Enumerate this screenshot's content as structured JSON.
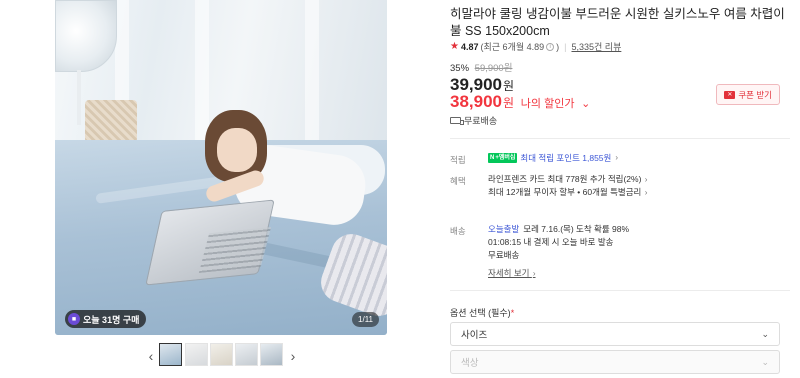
{
  "gallery": {
    "buy_badge": "오늘 31명 구매",
    "photo_count": "1/11",
    "prev_arrow": "‹",
    "next_arrow": "›",
    "thumbnails": [
      "thumb-1",
      "thumb-2",
      "thumb-3",
      "thumb-4",
      "thumb-5"
    ]
  },
  "product": {
    "title": "히말라야 쿨링 냉감이불 부드러운 시원한 실키스노우 여름 차렵이불 SS 150x200cm",
    "rating_score": "4.87",
    "rating_detail": "(최근 6개월 4.89",
    "rating_info_icon": "i",
    "rating_detail_end": ")",
    "review_count": "5,335건 리뷰",
    "discount_rate": "35%",
    "original_price": "59,900원",
    "price": "39,900",
    "price_unit": "원",
    "my_price": "38,900",
    "my_price_unit": "원",
    "my_price_label": "나의 할인가",
    "coupon_button": "쿠폰 받기",
    "free_shipping": "무료배송"
  },
  "details": {
    "reward_label": "적립",
    "reward_badge": "+멤버십",
    "reward_text": "최대 적립 포인트 1,855원",
    "benefit_label": "혜택",
    "benefit_line1": "라인프렌즈 카드 최대 778원 추가 적립(2%)",
    "benefit_line2": "최대 12개월 무이자 할부 • 60개월 특별금리",
    "shipping_label": "배송",
    "shipping_today": "오늘출발",
    "shipping_line1": "모레 7.16.(목) 도착 확률 98%",
    "shipping_line2": "01:08:15  내 결제 시 오늘 바로 발송",
    "shipping_line3": "무료배송",
    "shipping_detail": "자세히 보기"
  },
  "options": {
    "title": "옵션 선택 (필수)",
    "required_mark": "*",
    "select1": "사이즈",
    "select2": "색상"
  },
  "colors": {
    "accent_red": "#f2353e",
    "link_blue": "#3d57d6",
    "naver_green": "#03c75a"
  }
}
